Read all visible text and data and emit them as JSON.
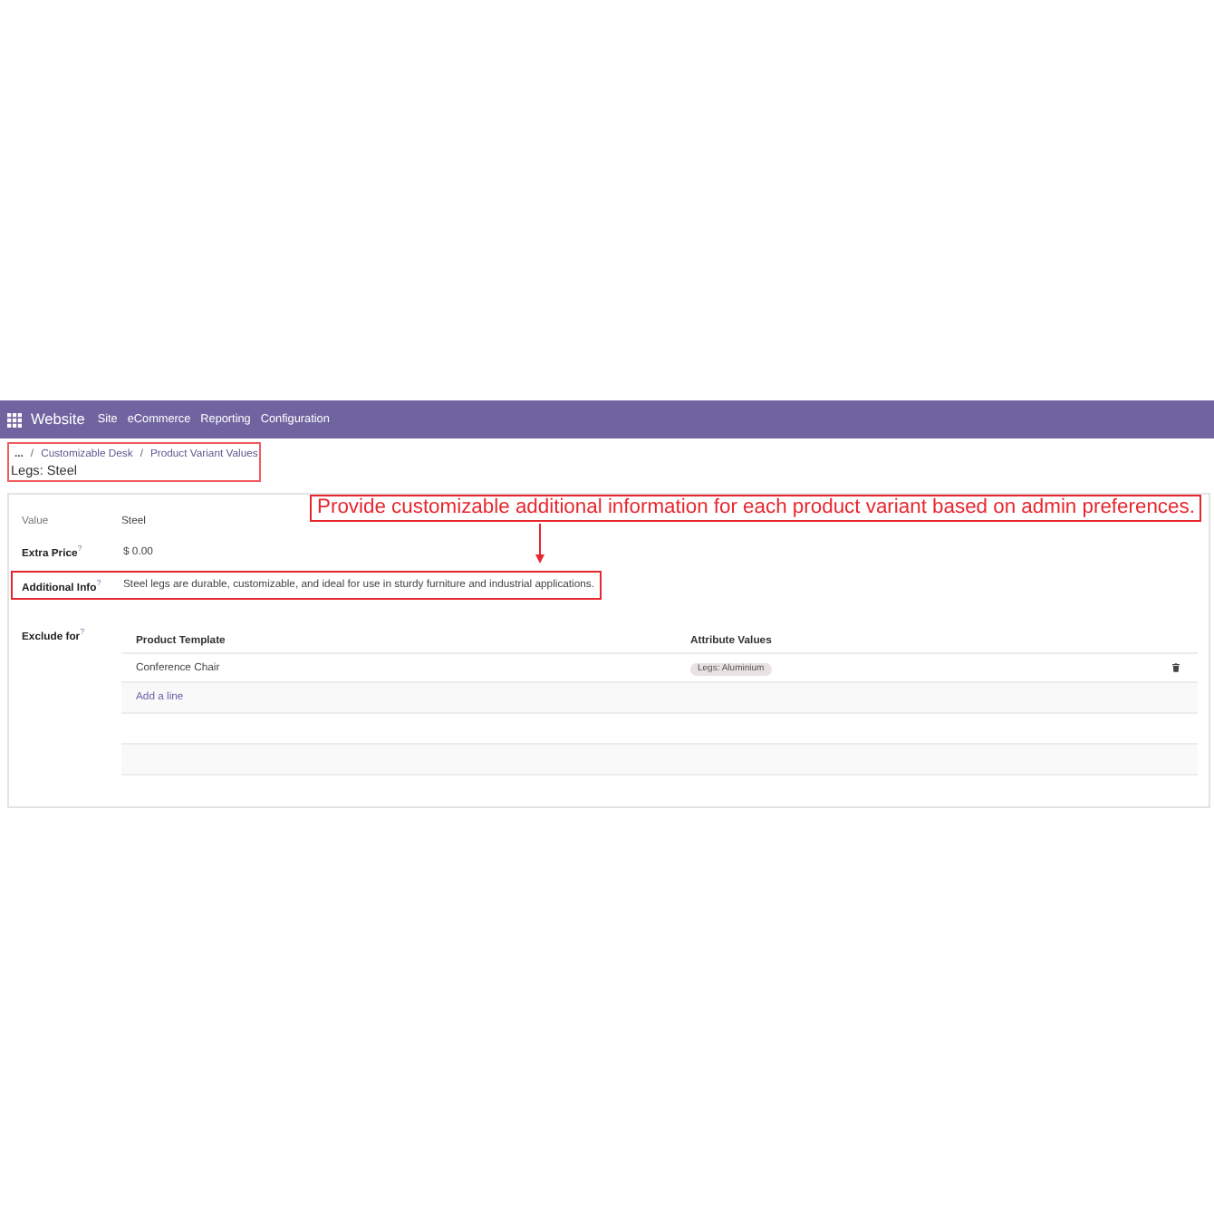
{
  "navbar": {
    "app": "Website",
    "menu": [
      {
        "label": "Site"
      },
      {
        "label": "eCommerce"
      },
      {
        "label": "Reporting"
      },
      {
        "label": "Configuration"
      }
    ]
  },
  "breadcrumb": {
    "highlighted": true,
    "items": [
      {
        "label": "..."
      },
      {
        "label": "Customizable Desk"
      },
      {
        "label": "Product Variant Values"
      }
    ],
    "separators": [
      "/",
      "/"
    ],
    "title": "Legs: Steel"
  },
  "form": {
    "fields": [
      {
        "label": "Value",
        "value": "Steel",
        "readonly": true,
        "highlighted": false
      },
      {
        "label": "Extra Price$^{?}$",
        "value": "$ 0.00",
        "readonly": false,
        "highlighted": false
      },
      {
        "label": "Additional Info$^{?}$",
        "value": "Steel legs are durable, customizable, and ideal for use in sturdy furniture and industrial applications.",
        "readonly": false,
        "highlighted": true
      }
    ],
    "exclude_for": {
      "label": "Exclude for$^{?}$",
      "columns": [
        "Product Template",
        "Attribute Values"
      ],
      "rows": [
        {
          "product_template": "Conference Chair",
          "attribute_values": [
            "Legs: Aluminium"
          ]
        }
      ],
      "add_line": "Add a line"
    }
  },
  "annotation": {
    "text": "Provide customizable additional information for each product variant based on admin preferences."
  }
}
